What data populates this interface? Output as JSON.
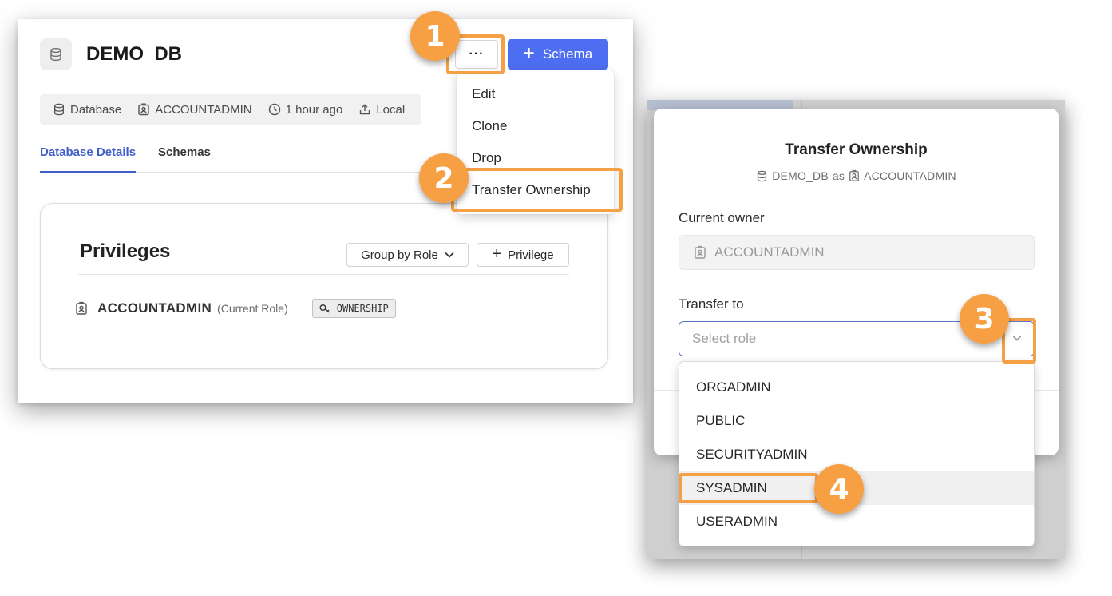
{
  "database": {
    "name": "DEMO_DB",
    "more_label": "···",
    "schema_button": "Schema",
    "meta": {
      "type": "Database",
      "owner": "ACCOUNTADMIN",
      "time": "1 hour ago",
      "source": "Local"
    },
    "tabs": [
      "Database Details",
      "Schemas"
    ]
  },
  "privileges": {
    "title": "Privileges",
    "group_by": "Group by Role",
    "add_privilege": "Privilege",
    "rows": [
      {
        "role": "ACCOUNTADMIN",
        "note": "(Current Role)",
        "privilege": "OWNERSHIP"
      }
    ]
  },
  "action_menu": {
    "items": [
      "Edit",
      "Clone",
      "Drop",
      "Transfer Ownership"
    ]
  },
  "modal": {
    "title": "Transfer Ownership",
    "sub_db": "DEMO_DB",
    "sub_as": "as",
    "sub_role": "ACCOUNTADMIN",
    "current_owner_label": "Current owner",
    "current_owner_value": "ACCOUNTADMIN",
    "transfer_to_label": "Transfer to",
    "select_placeholder": "Select role",
    "roles": [
      "ORGADMIN",
      "PUBLIC",
      "SECURITYADMIN",
      "SYSADMIN",
      "USERADMIN"
    ],
    "hovered_role": "SYSADMIN"
  },
  "steps": [
    "1",
    "2",
    "3",
    "4"
  ],
  "colors": {
    "accent": "#4d6ef0",
    "callout": "#f7a043",
    "tab_active": "#3f5ec7"
  }
}
